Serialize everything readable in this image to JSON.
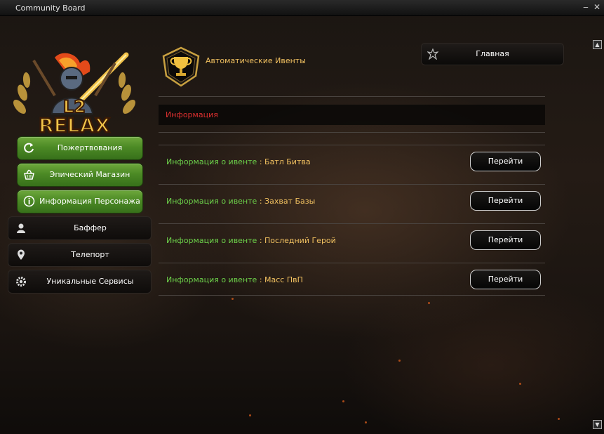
{
  "window": {
    "title": "Community Board"
  },
  "logo": {
    "text_top": "L2",
    "text_bottom": "RELAX"
  },
  "sidebar": {
    "green_items": [
      {
        "label": "Пожертвования",
        "icon": "refresh-icon"
      },
      {
        "label": "Эпический Магазин",
        "icon": "basket-icon"
      },
      {
        "label": "Информация Персонажа",
        "icon": "info-icon"
      }
    ],
    "dark_items": [
      {
        "label": "Баффер",
        "icon": "person-icon"
      },
      {
        "label": "Телепорт",
        "icon": "map-pin-icon"
      },
      {
        "label": "Уникальные Сервисы",
        "icon": "gear-icon"
      }
    ]
  },
  "header": {
    "title": "Автоматические Ивенты",
    "home_label": "Главная"
  },
  "info_bar": {
    "label": "Информация"
  },
  "events": [
    {
      "prefix": "Информация о ивенте",
      "separator": " : ",
      "name": "Батл Битва",
      "button": "Перейти"
    },
    {
      "prefix": "Информация о ивенте",
      "separator": " : ",
      "name": "Захват Базы",
      "button": "Перейти"
    },
    {
      "prefix": "Информация о ивенте",
      "separator": " : ",
      "name": "Последний Герой",
      "button": "Перейти"
    },
    {
      "prefix": "Информация о ивенте",
      "separator": " : ",
      "name": "Масс ПвП",
      "button": "Перейти"
    }
  ],
  "colors": {
    "accent_gold": "#f0c060",
    "event_green": "#6cd04a",
    "info_red": "#e03030",
    "button_green": "#4c8a25"
  }
}
